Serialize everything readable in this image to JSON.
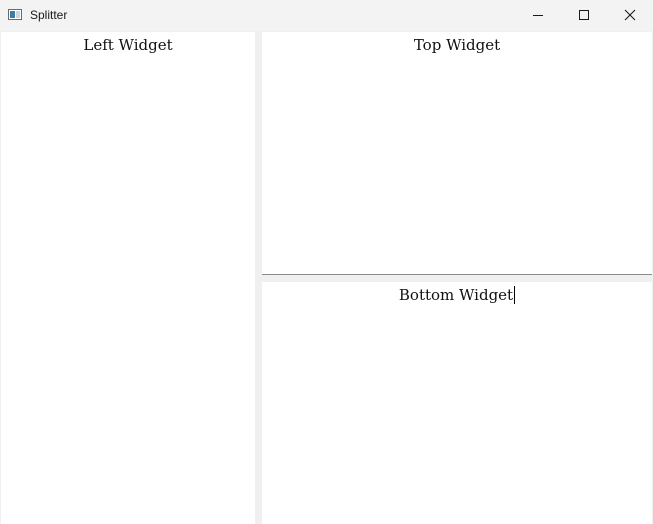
{
  "window": {
    "title": "Splitter",
    "controls": {
      "minimize": "minimize-icon",
      "maximize": "maximize-icon",
      "close": "close-icon"
    }
  },
  "panes": {
    "left": {
      "label": "Left Widget"
    },
    "top": {
      "label": "Top Widget"
    },
    "bottom": {
      "label": "Bottom Widget"
    }
  },
  "colors": {
    "titlebar": "#f3f3f3",
    "pane_background": "#ffffff",
    "splitter": "#f0f0f0"
  }
}
